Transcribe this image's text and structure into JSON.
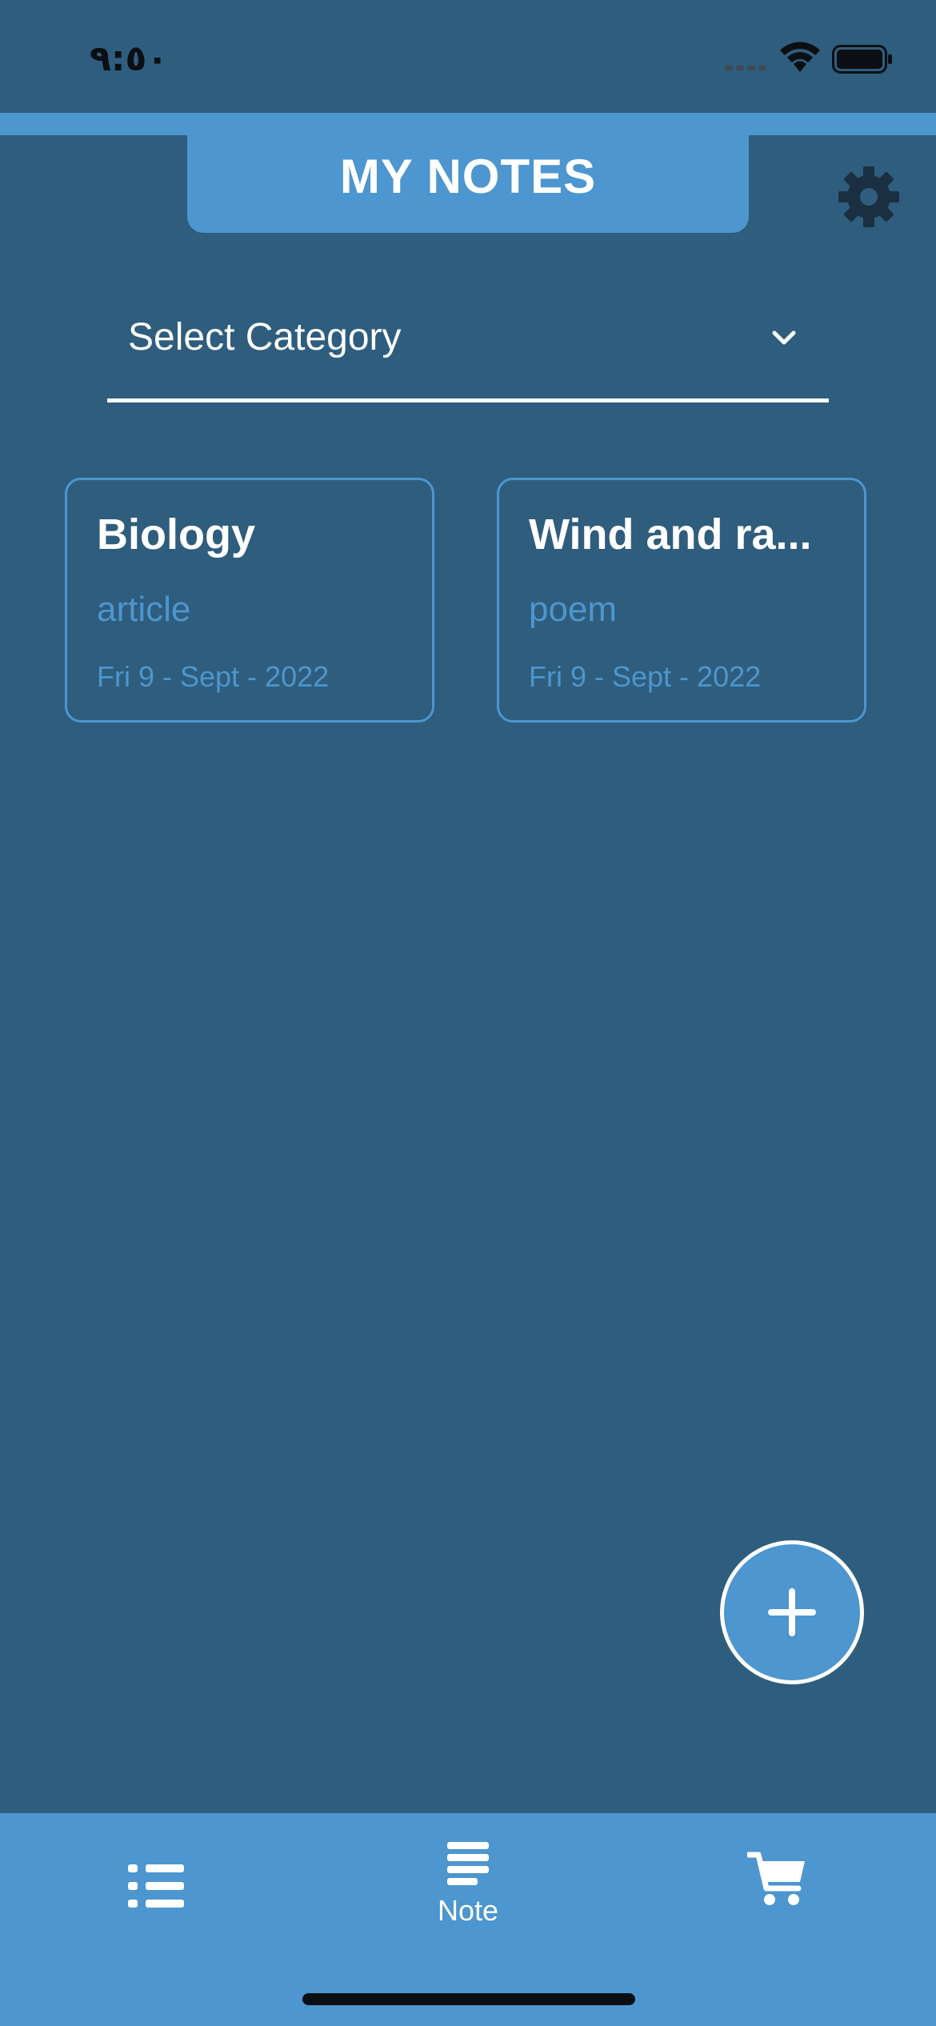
{
  "status_bar": {
    "time": "٩:٥٠"
  },
  "header": {
    "title": "MY NOTES",
    "settings_icon": "gear-icon"
  },
  "category_select": {
    "label": "Select Category",
    "icon": "chevron-down-icon"
  },
  "notes": [
    {
      "title": "Biology",
      "category": "article",
      "date": "Fri 9 - Sept - 2022"
    },
    {
      "title": "Wind and ra...",
      "category": "poem",
      "date": "Fri 9 - Sept - 2022"
    }
  ],
  "fab": {
    "icon": "plus-icon"
  },
  "bottom_nav": {
    "items": [
      {
        "icon": "list-icon",
        "label": ""
      },
      {
        "icon": "note-icon",
        "label": "Note"
      },
      {
        "icon": "cart-icon",
        "label": ""
      }
    ]
  },
  "colors": {
    "background": "#2f5d7d",
    "accent": "#4d96cf",
    "text": "#ffffff",
    "gear": "#1b2f42"
  }
}
